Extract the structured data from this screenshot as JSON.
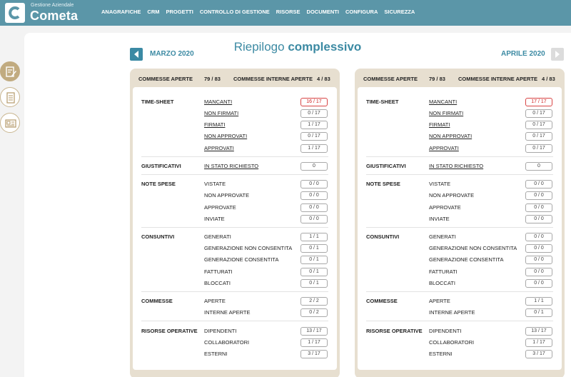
{
  "app": {
    "subtitle": "Gestione Aziendale",
    "name": "Cometa"
  },
  "nav": [
    "ANAGRAFICHE",
    "CRM",
    "PROGETTI",
    "CONTROLLO DI GESTIONE",
    "RISORSE",
    "DOCUMENTI",
    "CONFIGURA",
    "SICUREZZA"
  ],
  "sidebar": {
    "icons": [
      "timesheet-edit-icon",
      "list-document-icon",
      "newspaper-icon"
    ]
  },
  "page": {
    "title_light": "Riepilogo",
    "title_bold": "complessivo",
    "prev_month": "MARZO 2020",
    "next_month": "APRILE 2020"
  },
  "panels": [
    {
      "header": {
        "commesse_aperte_label": "COMMESSE APERTE",
        "commesse_aperte_value": "79 / 83",
        "commesse_interne_label": "COMMESSE INTERNE APERTE",
        "commesse_interne_value": "4 / 83"
      },
      "rows": {
        "ts_mancanti": "16 / 17",
        "ts_non_firmati": "0 / 17",
        "ts_firmati": "1 / 17",
        "ts_non_approvati": "0 / 17",
        "ts_approvati": "1 / 17",
        "giu_richiesto": "0",
        "ns_vistate": "0 / 0",
        "ns_non_approvate": "0 / 0",
        "ns_approvate": "0 / 0",
        "ns_inviate": "0 / 0",
        "co_generati": "1 / 1",
        "co_gen_non_consentita": "0 / 1",
        "co_gen_consentita": "0 / 1",
        "co_fatturati": "0 / 1",
        "co_bloccati": "0 / 1",
        "cm_aperte": "2 / 2",
        "cm_interne_aperte": "0 / 2",
        "ro_dipendenti": "13 / 17",
        "ro_collaboratori": "1 / 17",
        "ro_esterni": "3 / 17"
      }
    },
    {
      "header": {
        "commesse_aperte_label": "COMMESSE APERTE",
        "commesse_aperte_value": "79 / 83",
        "commesse_interne_label": "COMMESSE INTERNE APERTE",
        "commesse_interne_value": "4 / 83"
      },
      "rows": {
        "ts_mancanti": "17 / 17",
        "ts_non_firmati": "0 / 17",
        "ts_firmati": "0 / 17",
        "ts_non_approvati": "0 / 17",
        "ts_approvati": "0 / 17",
        "giu_richiesto": "0",
        "ns_vistate": "0 / 0",
        "ns_non_approvate": "0 / 0",
        "ns_approvate": "0 / 0",
        "ns_inviate": "0 / 0",
        "co_generati": "0 / 0",
        "co_gen_non_consentita": "0 / 0",
        "co_gen_consentita": "0 / 0",
        "co_fatturati": "0 / 0",
        "co_bloccati": "0 / 0",
        "cm_aperte": "1 / 1",
        "cm_interne_aperte": "0 / 1",
        "ro_dipendenti": "13 / 17",
        "ro_collaboratori": "1 / 17",
        "ro_esterni": "3 / 17"
      }
    }
  ],
  "labels": {
    "sections": {
      "timesheet": "TIME-SHEET",
      "giustificativi": "GIUSTIFICATIVI",
      "note_spese": "NOTE SPESE",
      "consuntivi": "CONSUNTIVI",
      "commesse": "COMMESSE",
      "risorse": "RISORSE OPERATIVE"
    },
    "rows": {
      "ts_mancanti": "MANCANTI",
      "ts_non_firmati": "NON FIRMATI",
      "ts_firmati": "FIRMATI",
      "ts_non_approvati": "NON APPROVATI",
      "ts_approvati": "APPROVATI",
      "giu_richiesto": "IN STATO RICHIESTO",
      "ns_vistate": "VISTATE",
      "ns_non_approvate": "NON APPROVATE",
      "ns_approvate": "APPROVATE",
      "ns_inviate": "INVIATE",
      "co_generati": "GENERATI",
      "co_gen_non_consentita": "GENERAZIONE NON CONSENTITA",
      "co_gen_consentita": "GENERAZIONE CONSENTITA",
      "co_fatturati": "FATTURATI",
      "co_bloccati": "BLOCCATI",
      "cm_aperte": "APERTE",
      "cm_interne_aperte": "INTERNE APERTE",
      "ro_dipendenti": "DIPENDENTI",
      "ro_collaboratori": "COLLABORATORI",
      "ro_esterni": "ESTERNI"
    }
  },
  "colors": {
    "header_bar": "#5b96a8",
    "accent": "#3c8aa3",
    "panel_bg": "#e7dfd0",
    "alert": "#d84444",
    "sidebar_active": "#c1ab80"
  }
}
